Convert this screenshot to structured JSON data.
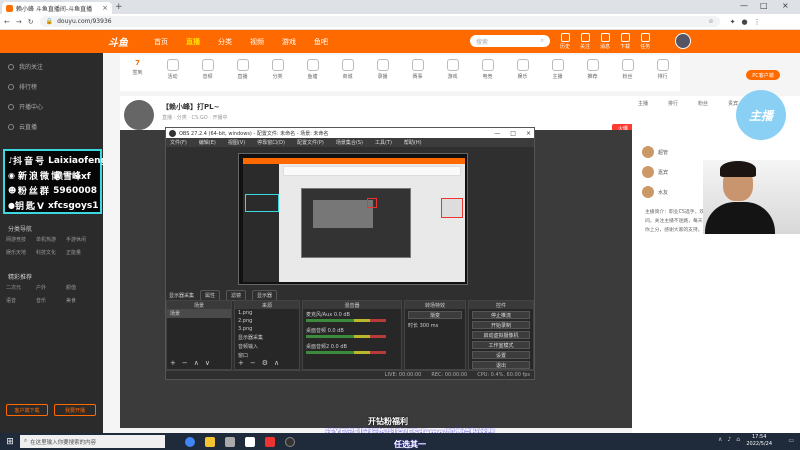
{
  "browser": {
    "tab_title": "赖小峰 斗鱼直播间-斗鱼直播",
    "url": "douyu.com/93936"
  },
  "header": {
    "logo": "斗鱼",
    "nav": [
      "首页",
      "直播",
      "分类",
      "视频",
      "游戏",
      "鱼吧"
    ],
    "search_placeholder": "搜索",
    "icons": [
      "历史",
      "关注",
      "消息",
      "下载",
      "任务"
    ]
  },
  "left_sidebar": {
    "items": [
      "我的关注",
      "排行榜",
      "开播中心",
      "云直播"
    ],
    "grid": [
      "网游竞技",
      "单机热游",
      "手游休闲",
      "娱乐天地",
      "科技文化",
      "正能量",
      "二次元",
      "户外",
      "颜值",
      "语音",
      "音乐",
      "美食"
    ],
    "sections": [
      "分类导航",
      "精彩推荐"
    ],
    "buttons": [
      "客户端下载",
      "我要开播"
    ]
  },
  "overlay": {
    "rows": [
      {
        "icon": "♪",
        "label": "抖音号",
        "value": "Laixiaofeng"
      },
      {
        "icon": "◉",
        "label": "新浪微博",
        "value": "赖雪峰xf"
      },
      {
        "icon": "☻",
        "label": "粉丝群",
        "value": "5960008"
      },
      {
        "icon": "●",
        "label": "钥匙V",
        "value": "xfcsgoys1"
      }
    ]
  },
  "categories": {
    "first_num": "7",
    "items": [
      "签到",
      "活动",
      "音频",
      "直播",
      "分类",
      "鱼塘",
      "商城",
      "录播",
      "赛事",
      "游戏",
      "电竞",
      "娱乐",
      "主播",
      "推荐",
      "粉丝",
      "排行"
    ],
    "pc_button": "PC客户端"
  },
  "stream": {
    "title": "【赖小峰】打PL~",
    "subtitle": "直播 · 分类 · CS:GO · 开播中",
    "hot": "火爆"
  },
  "obs": {
    "title": "OBS 27.2.4 (64-bit, windows) - 配置文件: 未命名 - 场景: 未命名",
    "menu": [
      "文件(F)",
      "编辑(E)",
      "视图(V)",
      "停靠窗口(D)",
      "配置文件(P)",
      "场景集合(S)",
      "工具(T)",
      "帮助(H)"
    ],
    "dock": [
      "显示器采集",
      "属性",
      "滤镜",
      "显示器"
    ],
    "scenes_header": "场景",
    "scenes": [
      "场景"
    ],
    "sources_header": "来源",
    "sources": [
      "1.png",
      "2.png",
      "3.png",
      "显示器采集",
      "音频输入",
      "窗口"
    ],
    "mixer_header": "混音器",
    "mixer": [
      {
        "name": "麦克风/Aux",
        "db": "0.0 dB"
      },
      {
        "name": "桌面音频",
        "db": "0.0 dB"
      },
      {
        "name": "桌面音频2",
        "db": "0.0 dB"
      }
    ],
    "transitions_header": "转场特效",
    "transition": "渐变",
    "duration_label": "时长",
    "duration": "300 ms",
    "controls_header": "控件",
    "controls": [
      "停止推流",
      "开始录制",
      "启动虚拟摄像机",
      "工作室模式",
      "设置",
      "退出"
    ],
    "status": [
      "LIVE: 00:00:00",
      "REC: 00:00:00",
      "CPU: 0.4%, 60.00 fps"
    ]
  },
  "right_panel": {
    "tabs": [
      "主播",
      "排行",
      "粉丝",
      "贵宾"
    ],
    "users": [
      "超管",
      "嘉宾",
      "水友"
    ],
    "text": "主播简介：职业CS选手，欢迎大家来到直播间，关注主播不迷路，每天下午准时开播，带你上分，感谢大家的支持。"
  },
  "bubble": "主播",
  "banner": {
    "line1": "开钻粉福利",
    "line2": "送XF定制鼠标垫/抖空/ESdemo/加微信粉丝群",
    "line3": "任选其一"
  },
  "taskbar": {
    "search_placeholder": "在这里输入你要搜索的内容",
    "time": "17:54",
    "date": "2022/5/24"
  }
}
